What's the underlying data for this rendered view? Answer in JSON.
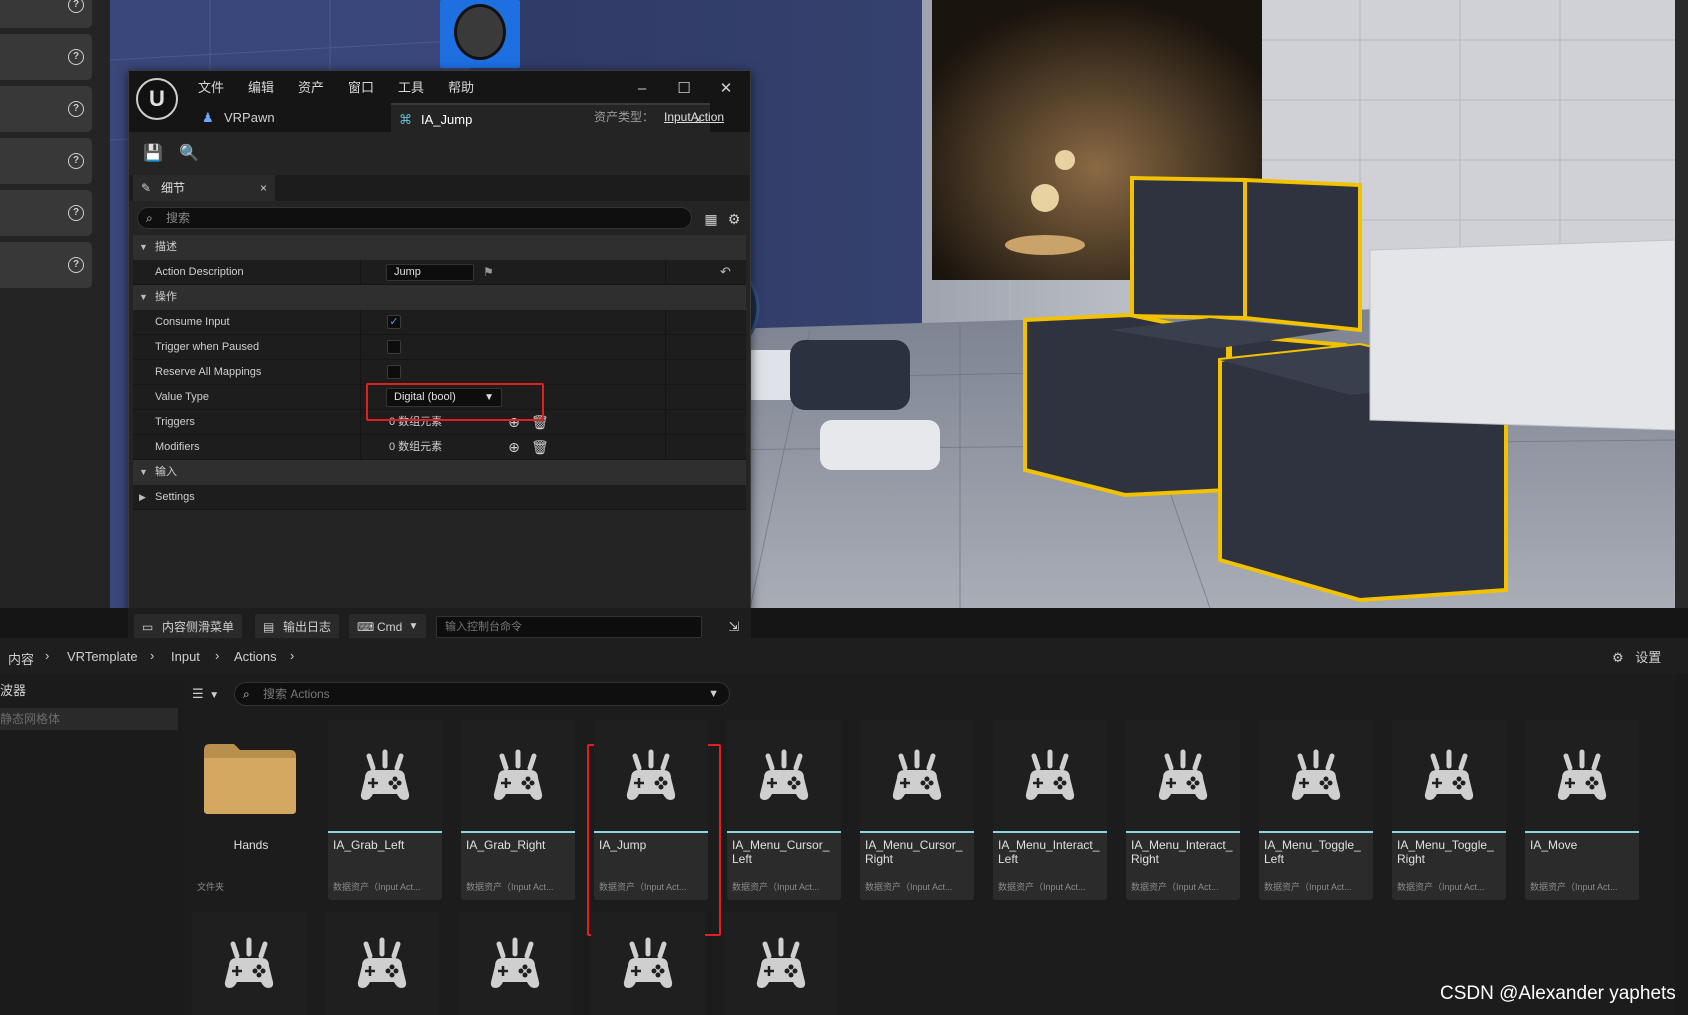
{
  "editor_window": {
    "menu": [
      "文件",
      "编辑",
      "资产",
      "窗口",
      "工具",
      "帮助"
    ],
    "tabs": {
      "vrpawn": "VRPawn",
      "ia_jump": "IA_Jump"
    },
    "asset_type_label": "资产类型：",
    "asset_type_value": "InputAction",
    "details_tab": "细节",
    "search_placeholder": "搜索",
    "sections": {
      "description": "描述",
      "action": "操作",
      "input": "输入"
    },
    "props": {
      "action_description": {
        "label": "Action Description",
        "value": "Jump"
      },
      "consume_input": {
        "label": "Consume Input",
        "checked": true
      },
      "trigger_when_paused": {
        "label": "Trigger when Paused",
        "checked": false
      },
      "reserve_all_mappings": {
        "label": "Reserve All Mappings",
        "checked": false
      },
      "value_type": {
        "label": "Value Type",
        "value": "Digital (bool)"
      },
      "triggers": {
        "label": "Triggers",
        "value": "0 数组元素"
      },
      "modifiers": {
        "label": "Modifiers",
        "value": "0 数组元素"
      },
      "settings": {
        "label": "Settings"
      }
    }
  },
  "console": {
    "content_drawer": "内容侧滑菜单",
    "output_log": "输出日志",
    "cmd": "Cmd",
    "input_placeholder": "输入控制台命令"
  },
  "content_browser": {
    "breadcrumb": [
      "内容",
      "VRTemplate",
      "Input",
      "Actions"
    ],
    "settings_label": "设置",
    "left_header": "波器",
    "left_item": "静态网格体",
    "search_placeholder": "搜索 Actions",
    "folder": {
      "name": "Hands",
      "type": "文件夹"
    },
    "assets_row1": [
      {
        "name": "IA_Grab_Left",
        "type": "数据资产（Input Act..."
      },
      {
        "name": "IA_Grab_Right",
        "type": "数据资产（Input Act..."
      },
      {
        "name": "IA_Jump",
        "type": "数据资产（Input Act..."
      },
      {
        "name": "IA_Menu_Cursor_\nLeft",
        "type": "数据资产（Input Act..."
      },
      {
        "name": "IA_Menu_Cursor_\nRight",
        "type": "数据资产（Input Act..."
      },
      {
        "name": "IA_Menu_Interact_\nLeft",
        "type": "数据资产（Input Act..."
      },
      {
        "name": "IA_Menu_Interact_\nRight",
        "type": "数据资产（Input Act..."
      },
      {
        "name": "IA_Menu_Toggle_\nLeft",
        "type": "数据资产（Input Act..."
      },
      {
        "name": "IA_Menu_Toggle_\nRight",
        "type": "数据资产（Input Act..."
      },
      {
        "name": "IA_Move",
        "type": "数据资产（Input Act..."
      }
    ]
  },
  "watermark": "CSDN @Alexander yaphets",
  "colors": {
    "highlight_box": "#e41e1e",
    "accent": "#8ad6e6",
    "checkbox": "#4a9eff"
  }
}
